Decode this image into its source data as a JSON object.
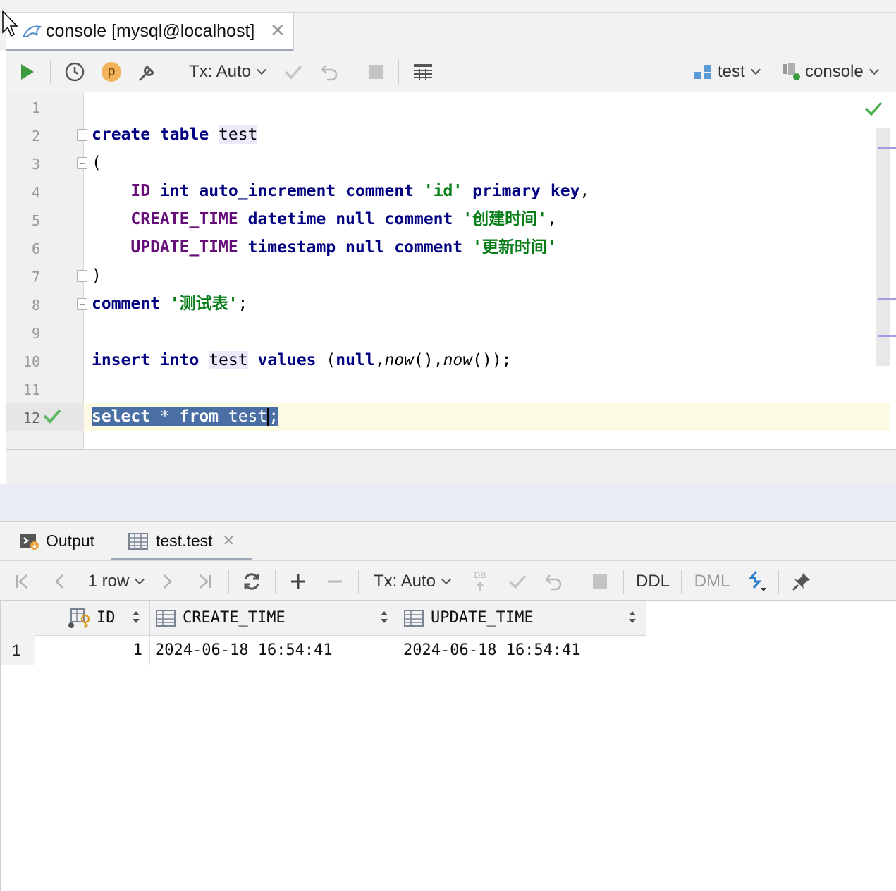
{
  "tab": {
    "title": "console [mysql@localhost]",
    "close_symbol": "✕"
  },
  "toolbar": {
    "tx_mode": "Tx: Auto",
    "p_badge": "p",
    "schema": "test",
    "session": "console"
  },
  "editor": {
    "line_numbers": [
      "1",
      "2",
      "3",
      "4",
      "5",
      "6",
      "7",
      "8",
      "9",
      "10",
      "11",
      "12"
    ],
    "lines": {
      "l2": {
        "kw1": "create table",
        "name": "test"
      },
      "l3": {
        "text": "("
      },
      "l4": {
        "col": "ID",
        "kw": "int auto_increment comment",
        "str": "'id'",
        "kw2": "primary key",
        "tail": ","
      },
      "l5": {
        "col": "CREATE_TIME",
        "kw": "datetime null comment",
        "str": "'创建时间'",
        "tail": ","
      },
      "l6": {
        "col": "UPDATE_TIME",
        "kw": "timestamp null comment",
        "str": "'更新时间'"
      },
      "l7": {
        "text": ")"
      },
      "l8": {
        "kw": "comment",
        "str": "'测试表'",
        "tail": ";"
      },
      "l10": {
        "kw": "insert into",
        "name": "test",
        "kw2": "values",
        "p1": " (",
        "kw3": "null",
        "p2": ",",
        "fn1": "now",
        "p3": "(),",
        "fn2": "now",
        "p4": "());"
      },
      "l12": {
        "kw1": "select",
        "star": " * ",
        "kw2": "from",
        "name": " test",
        "tail": ";"
      }
    },
    "status": "ok"
  },
  "results": {
    "tabs": [
      {
        "label": "Output"
      },
      {
        "label": "test.test",
        "close_symbol": "✕"
      }
    ],
    "toolbar": {
      "row_count": "1 row",
      "tx_mode": "Tx: Auto",
      "db_label": "DB",
      "ddl": "DDL",
      "dml": "DML"
    },
    "columns": [
      "ID",
      "CREATE_TIME",
      "UPDATE_TIME"
    ],
    "rows": [
      {
        "num": "1",
        "cells": [
          "1",
          "2024-06-18 16:54:41",
          "2024-06-18 16:54:41"
        ]
      }
    ]
  },
  "colors": {
    "keyword": "#000080",
    "column": "#660e7a",
    "string": "#067d17",
    "run_green": "#3c9b3c",
    "selection": "#4a6fa5"
  }
}
